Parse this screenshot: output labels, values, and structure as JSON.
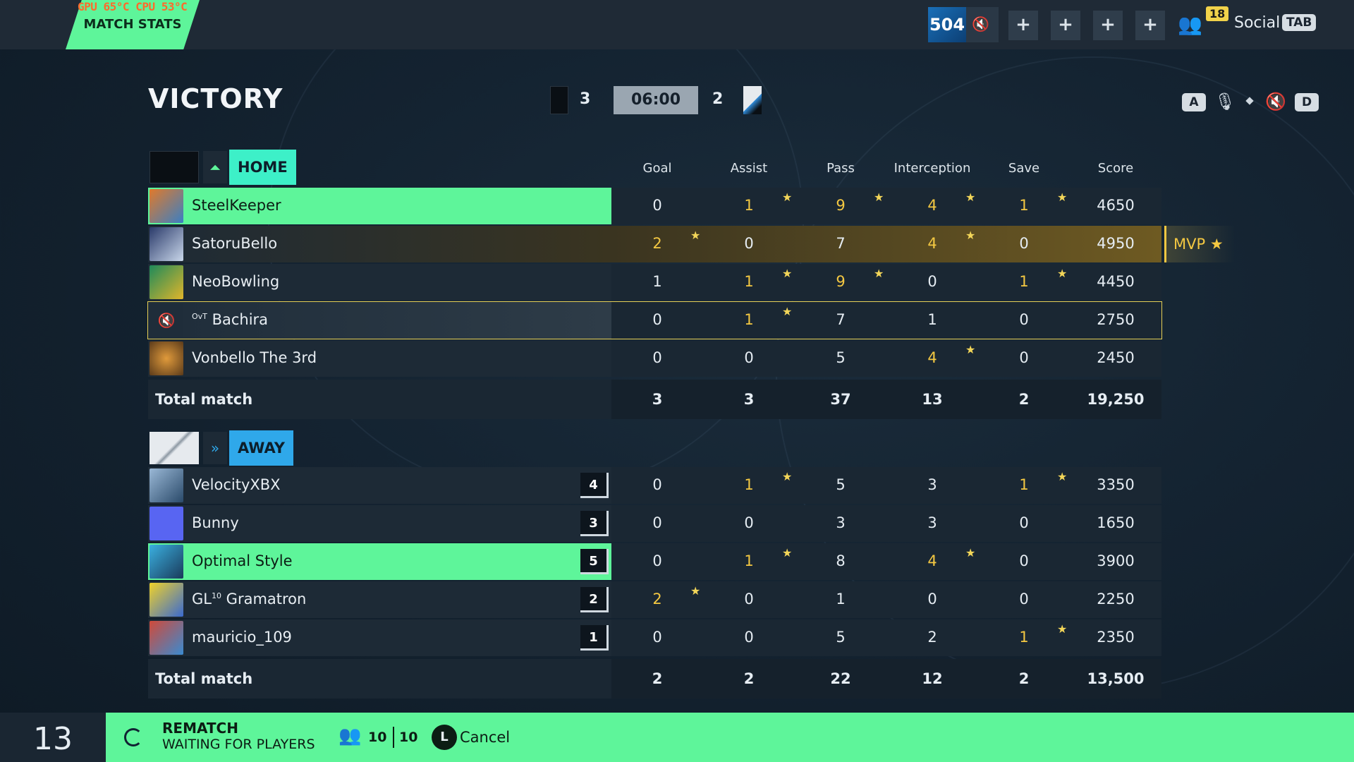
{
  "topbar": {
    "hw_stats": "GPU 65°C  CPU 53°C",
    "match_stats_tab": "MATCH STATS",
    "level": "504",
    "friends_count": "18",
    "social_label": "Social",
    "social_key": "TAB",
    "plus_buttons": [
      "+",
      "+",
      "+",
      "+"
    ]
  },
  "header": {
    "result": "VICTORY",
    "home_score": "3",
    "timer": "06:00",
    "away_score": "2",
    "key_left": "A",
    "key_right": "D"
  },
  "columns": [
    "Goal",
    "Assist",
    "Pass",
    "Interception",
    "Save",
    "Score"
  ],
  "home": {
    "label": "HOME",
    "players": [
      {
        "name": "SteelKeeper",
        "highlight": "green",
        "goal": "0",
        "assist": "1",
        "pass": "9",
        "interception": "4",
        "save": "1",
        "score": "4650"
      },
      {
        "name": "SatoruBello",
        "highlight": "mvp",
        "goal": "2",
        "assist": "0",
        "pass": "7",
        "interception": "4",
        "save": "0",
        "score": "4950"
      },
      {
        "name": "NeoBowling",
        "highlight": "",
        "goal": "1",
        "assist": "1",
        "pass": "9",
        "interception": "0",
        "save": "1",
        "score": "4450"
      },
      {
        "name": "Bachira",
        "tag": "OvT",
        "highlight": "self",
        "goal": "0",
        "assist": "1",
        "pass": "7",
        "interception": "1",
        "save": "0",
        "score": "2750"
      },
      {
        "name": "Vonbello The 3rd",
        "highlight": "",
        "goal": "0",
        "assist": "0",
        "pass": "5",
        "interception": "4",
        "save": "0",
        "score": "2450"
      }
    ],
    "total": {
      "label": "Total match",
      "goal": "3",
      "assist": "3",
      "pass": "37",
      "interception": "13",
      "save": "2",
      "score": "19,250"
    }
  },
  "away": {
    "label": "AWAY",
    "players": [
      {
        "name": "VelocityXBX",
        "rank": "4",
        "highlight": "",
        "goal": "0",
        "assist": "1",
        "pass": "5",
        "interception": "3",
        "save": "1",
        "score": "3350"
      },
      {
        "name": "Bunny",
        "rank": "3",
        "highlight": "",
        "goal": "0",
        "assist": "0",
        "pass": "3",
        "interception": "3",
        "save": "0",
        "score": "1650"
      },
      {
        "name": "Optimal Style",
        "rank": "5",
        "highlight": "green",
        "goal": "0",
        "assist": "1",
        "pass": "8",
        "interception": "4",
        "save": "0",
        "score": "3900"
      },
      {
        "name": "Gramatron",
        "tag": "GL",
        "tag_sup": "10",
        "rank": "2",
        "highlight": "",
        "goal": "2",
        "assist": "0",
        "pass": "1",
        "interception": "0",
        "save": "0",
        "score": "2250"
      },
      {
        "name": "mauricio_109",
        "rank": "1",
        "highlight": "",
        "goal": "0",
        "assist": "0",
        "pass": "5",
        "interception": "2",
        "save": "1",
        "score": "2350"
      }
    ],
    "total": {
      "label": "Total match",
      "goal": "2",
      "assist": "2",
      "pass": "22",
      "interception": "12",
      "save": "2",
      "score": "13,500"
    }
  },
  "mvp_label": "MVP",
  "bottom": {
    "countdown": "13",
    "rematch": "REMATCH",
    "waiting": "WAITING FOR PLAYERS",
    "ready": "10",
    "total": "10",
    "cancel_key": "L",
    "cancel": "Cancel"
  },
  "colors": {
    "accent_green": "#5ef59a",
    "home_cyan": "#3df0c8",
    "away_blue": "#2fa8ea",
    "gold": "#f4c842",
    "star": "#f3d659"
  }
}
